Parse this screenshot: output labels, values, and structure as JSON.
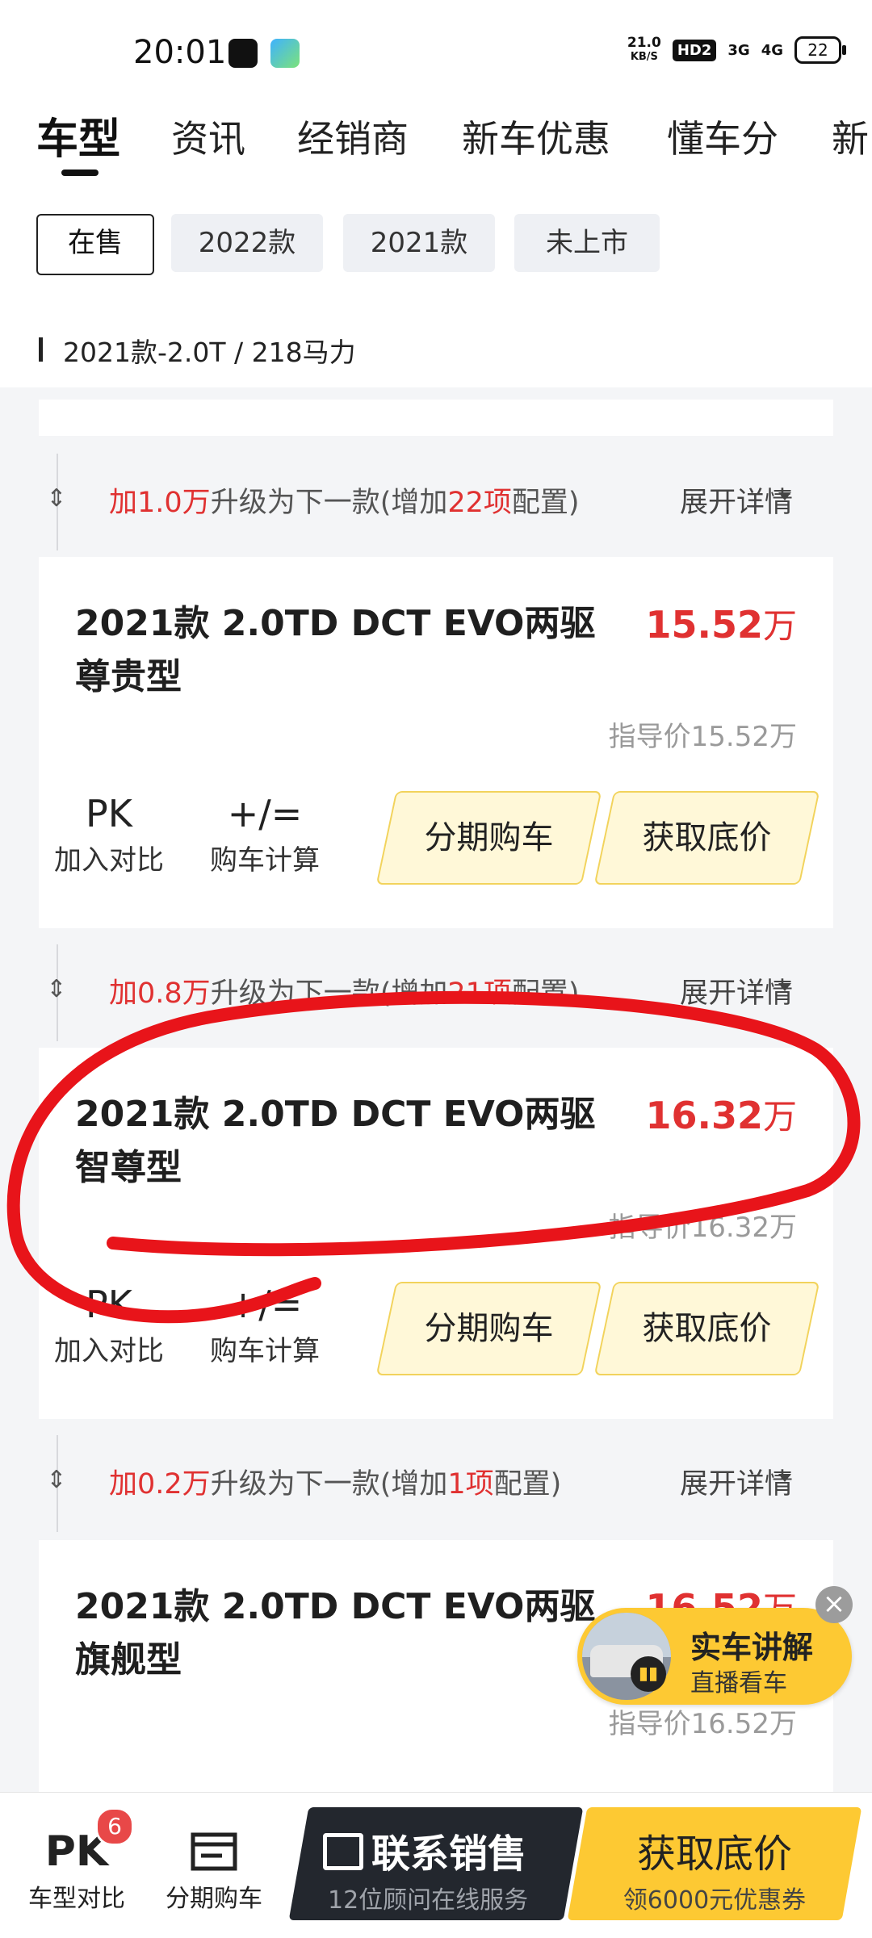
{
  "status_bar": {
    "time": "20:01",
    "apps": [
      "tiktok-icon",
      "video-app-icon"
    ],
    "net_speed_value": "21.0",
    "net_speed_unit": "KB/S",
    "hd": "HD2",
    "signal1": "3G",
    "signal2": "4G",
    "battery": "22"
  },
  "tabs": [
    "车型",
    "资讯",
    "经销商",
    "新车优惠",
    "懂车分",
    "新"
  ],
  "filters": [
    "在售",
    "2022款",
    "2021款",
    "未上市"
  ],
  "section_label": "2021款-2.0T / 218马力",
  "upgrades": [
    {
      "pre": "加",
      "price": "1.0万",
      "mid": "升级为下一款(增加",
      "count": "22项",
      "post": "配置)",
      "expand": "展开详情"
    },
    {
      "pre": "加",
      "price": "0.8万",
      "mid": "升级为下一款(增加",
      "count": "21项",
      "post": "配置)",
      "expand": "展开详情"
    },
    {
      "pre": "加",
      "price": "0.2万",
      "mid": "升级为下一款(增加",
      "count": "1项",
      "post": "配置)",
      "expand": "展开详情"
    }
  ],
  "cars": [
    {
      "name": "2021款 2.0TD DCT EVO两驱尊贵型",
      "price": "15.52",
      "unit": "万",
      "guide": "指导价15.52万"
    },
    {
      "name": "2021款 2.0TD DCT EVO两驱智尊型",
      "price": "16.32",
      "unit": "万",
      "guide": "指导价16.32万"
    },
    {
      "name": "2021款 2.0TD DCT EVO两驱旗舰型",
      "price": "16.52",
      "unit": "万",
      "guide": "指导价16.52万"
    }
  ],
  "card_actions": {
    "pk_icon": "PK",
    "pk_label": "加入对比",
    "calc_icon": "+/=",
    "calc_label": "购车计算",
    "installment": "分期购车",
    "lowest_price": "获取底价"
  },
  "live": {
    "title": "实车讲解",
    "subtitle": "直播看车",
    "close": "×"
  },
  "bottom_bar": {
    "compare_icon": "PK",
    "compare_label": "车型对比",
    "compare_badge": "6",
    "installment_label": "分期购车",
    "contact_title": "联系销售",
    "contact_sub": "12位顾问在线服务",
    "getprice_title": "获取底价",
    "getprice_sub": "领6000元优惠券"
  },
  "colors": {
    "price_red": "#e03131",
    "accent_yellow": "#fdc933",
    "annotation_red": "#e8141a"
  }
}
